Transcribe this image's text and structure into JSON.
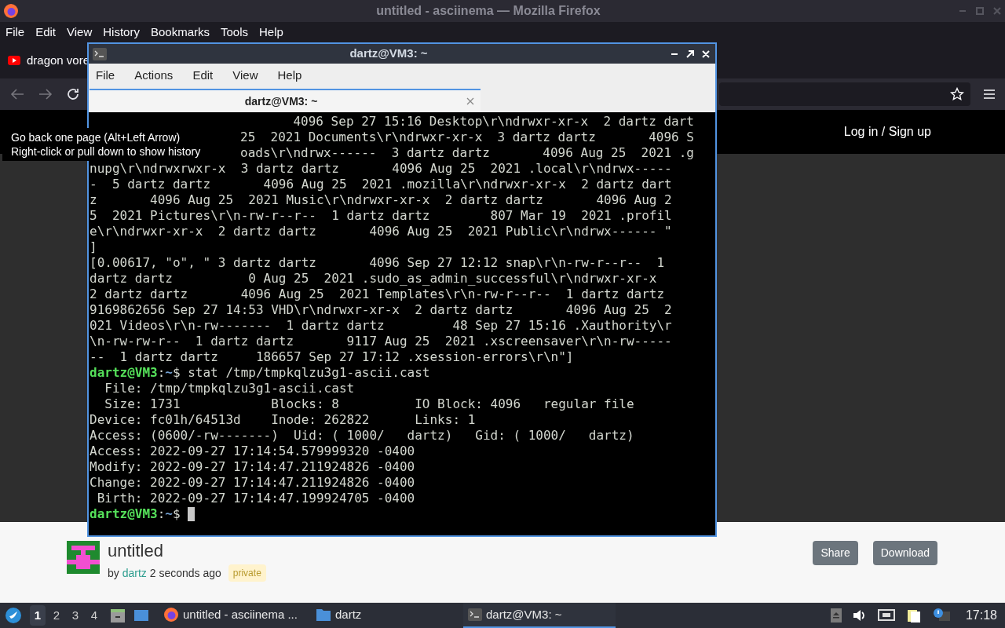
{
  "firefox": {
    "title": "untitled - asciinema — Mozilla Firefox",
    "menu": [
      "File",
      "Edit",
      "View",
      "History",
      "Bookmarks",
      "Tools",
      "Help"
    ],
    "tabs": [
      {
        "label": "dragon vore"
      }
    ],
    "site": {
      "login": "Log in / Sign up"
    },
    "recording": {
      "title": "untitled",
      "by": "by",
      "author": "dartz",
      "time": "2 seconds ago",
      "badge": "private",
      "buttons": [
        "Share",
        "Download"
      ]
    }
  },
  "tooltip": {
    "lines": [
      "Go back one page (Alt+Left Arrow)",
      "Right-click or pull down to show history"
    ]
  },
  "terminal": {
    "title": "dartz@VM3: ~",
    "menu": [
      "File",
      "Actions",
      "Edit",
      "View",
      "Help"
    ],
    "tabs": [
      {
        "label": "dartz@VM3: ~",
        "selected": true
      }
    ],
    "lines": [
      {
        "kind": "partial",
        "text": "4096 Sep 27 15:16 Desktop\\r\\ndrwxr-xr-x  2 dartz dart"
      },
      {
        "kind": "partial",
        "text": "25  2021 Documents\\r\\ndrwxr-xr-x  3 dartz dartz       4096 S"
      },
      {
        "kind": "partial",
        "text": "oads\\r\\ndrwx------  3 dartz dartz       4096 Aug 25  2021 .g"
      },
      {
        "kind": "output",
        "text": "nupg\\r\\ndrwxrwxr-x  3 dartz dartz       4096 Aug 25  2021 .local\\r\\ndrwx-----"
      },
      {
        "kind": "output",
        "text": "-  5 dartz dartz       4096 Aug 25  2021 .mozilla\\r\\ndrwxr-xr-x  2 dartz dart"
      },
      {
        "kind": "output",
        "text": "z       4096 Aug 25  2021 Music\\r\\ndrwxr-xr-x  2 dartz dartz       4096 Aug 2"
      },
      {
        "kind": "output",
        "text": "5  2021 Pictures\\r\\n-rw-r--r--  1 dartz dartz        807 Mar 19  2021 .profil"
      },
      {
        "kind": "output",
        "text": "e\\r\\ndrwxr-xr-x  2 dartz dartz       4096 Aug 25  2021 Public\\r\\ndrwx------ \""
      },
      {
        "kind": "output",
        "text": "]"
      },
      {
        "kind": "output",
        "text": "[0.00617, \"o\", \" 3 dartz dartz       4096 Sep 27 12:12 snap\\r\\n-rw-r--r--  1"
      },
      {
        "kind": "output",
        "text": "dartz dartz          0 Aug 25  2021 .sudo_as_admin_successful\\r\\ndrwxr-xr-x"
      },
      {
        "kind": "output",
        "text": "2 dartz dartz       4096 Aug 25  2021 Templates\\r\\n-rw-r--r--  1 dartz dartz"
      },
      {
        "kind": "output",
        "text": "9169862656 Sep 27 14:53 VHD\\r\\ndrwxr-xr-x  2 dartz dartz       4096 Aug 25  2"
      },
      {
        "kind": "output",
        "text": "021 Videos\\r\\n-rw-------  1 dartz dartz         48 Sep 27 15:16 .Xauthority\\r"
      },
      {
        "kind": "output",
        "text": "\\n-rw-rw-r--  1 dartz dartz       9117 Aug 25  2021 .xscreensaver\\r\\n-rw-----"
      },
      {
        "kind": "output",
        "text": "--  1 dartz dartz     186657 Sep 27 17:12 .xsession-errors\\r\\n\"]"
      },
      {
        "kind": "prompt",
        "user": "dartz@VM3",
        "sep": ":",
        "path": "~",
        "symbol": "$",
        "command": "stat /tmp/tmpkqlzu3g1-ascii.cast",
        "cursor": false
      },
      {
        "kind": "output",
        "text": "  File: /tmp/tmpkqlzu3g1-ascii.cast"
      },
      {
        "kind": "output",
        "text": "  Size: 1731            Blocks: 8          IO Block: 4096   regular file"
      },
      {
        "kind": "output",
        "text": "Device: fc01h/64513d    Inode: 262822      Links: 1"
      },
      {
        "kind": "output",
        "text": "Access: (0600/-rw-------)  Uid: ( 1000/   dartz)   Gid: ( 1000/   dartz)"
      },
      {
        "kind": "output",
        "text": "Access: 2022-09-27 17:14:54.579999320 -0400"
      },
      {
        "kind": "output",
        "text": "Modify: 2022-09-27 17:14:47.211924826 -0400"
      },
      {
        "kind": "output",
        "text": "Change: 2022-09-27 17:14:47.211924826 -0400"
      },
      {
        "kind": "output",
        "text": " Birth: 2022-09-27 17:14:47.199924705 -0400"
      },
      {
        "kind": "prompt",
        "user": "dartz@VM3",
        "sep": ":",
        "path": "~",
        "symbol": "$",
        "cursor": true
      }
    ]
  },
  "taskbar": {
    "workspaces": [
      {
        "label": "1",
        "selected": true
      },
      {
        "label": "2",
        "selected": false
      },
      {
        "label": "3",
        "selected": false
      },
      {
        "label": "4",
        "selected": false
      }
    ],
    "tasks": [
      {
        "kind": "browser",
        "label": "untitled - asciinema ...",
        "selected": false
      },
      {
        "kind": "folder",
        "label": "dartz",
        "selected": false
      },
      {
        "kind": "terminal",
        "label": "dartz@VM3: ~",
        "selected": true
      }
    ],
    "clock": "17:18"
  }
}
